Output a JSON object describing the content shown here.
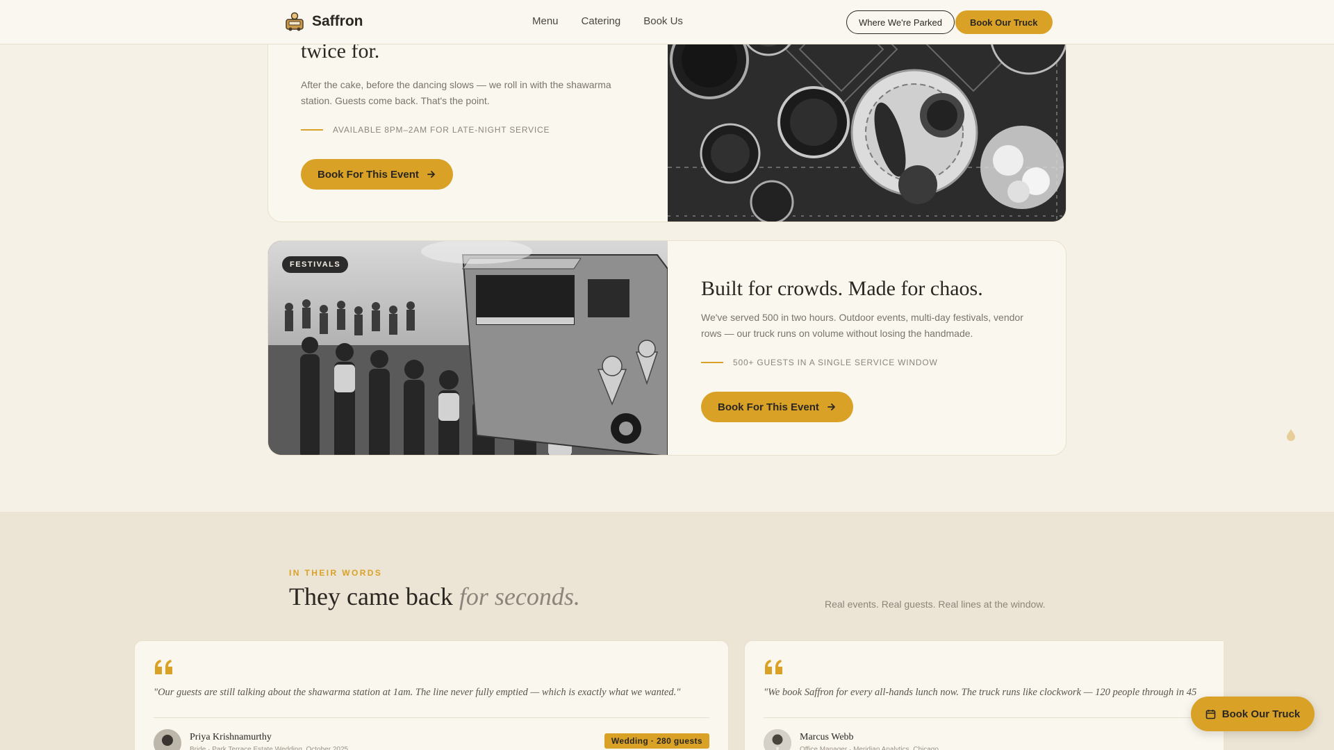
{
  "header": {
    "brand": "Saffron",
    "nav": [
      "Menu",
      "Catering",
      "Book Us"
    ],
    "location_button": "Where We're Parked",
    "book_button": "Book Our Truck"
  },
  "events": [
    {
      "title": "twice for.",
      "body": "After the cake, before the dancing slows — we roll in with the shawarma station. Guests come back. That's the point.",
      "meta": "AVAILABLE 8PM–2AM FOR LATE-NIGHT SERVICE",
      "cta": "Book For This Event"
    },
    {
      "badge": "FESTIVALS",
      "title": "Built for crowds. Made for chaos.",
      "body": "We've served 500 in two hours. Outdoor events, multi-day festivals, vendor rows — our truck runs on volume without losing the handmade.",
      "meta": "500+ GUESTS IN A SINGLE SERVICE WINDOW",
      "cta": "Book For This Event"
    }
  ],
  "testimonials": {
    "eyebrow": "IN THEIR WORDS",
    "heading_plain": "They came back",
    "heading_italic": "for seconds.",
    "subheading": "Real events. Real guests. Real lines at the window.",
    "items": [
      {
        "quote": "\"Our guests are still talking about the shawarma station at 1am. The line never fully emptied — which is exactly what we wanted.\"",
        "name": "Priya Krishnamurthy",
        "role": "Bride · Park Terrace Estate Wedding, October 2025",
        "badge": "Wedding · 280 guests"
      },
      {
        "quote": "\"We book Saffron for every all-hands lunch now. The truck runs like clockwork — 120 people through in 45",
        "name": "Marcus Webb",
        "role": "Office Manager · Meridian Analytics, Chicago"
      }
    ]
  },
  "floating_button": "Book Our Truck",
  "colors": {
    "accent": "#d9a227",
    "background": "#f6f1e6",
    "card": "#faf7ef",
    "text": "#2a2622"
  }
}
